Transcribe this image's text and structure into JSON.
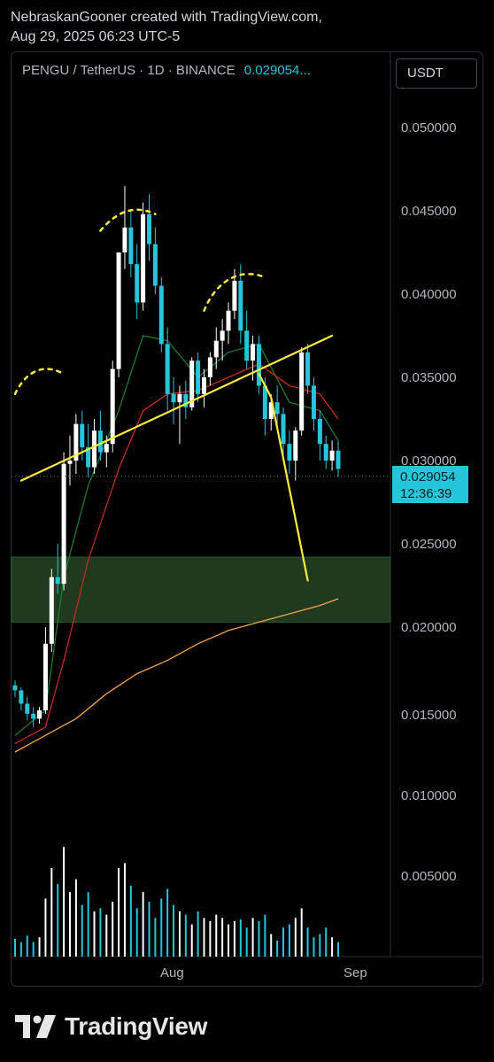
{
  "header": {
    "line1": "NebraskanGooner created with TradingView.com,",
    "line2": "Aug 29, 2025 06:23 UTC-5"
  },
  "symbol": {
    "label": "PENGU / TetherUS · 1D · BINANCE",
    "price": "0.029054..."
  },
  "currency_button": "USDT",
  "colors": {
    "up": "#ffffff",
    "down": "#26c6da",
    "accent": "#26c6da",
    "ema_short": "#1b7a2a",
    "ema_mid": "#c42b1c",
    "ema_long": "#f4a24c",
    "drawing": "#ffeb3b",
    "demand_zone": "#1f3a1f"
  },
  "brand": {
    "name": "TradingView",
    "icon": "tradingview-logo-icon"
  },
  "chart_data": {
    "type": "candlestick",
    "symbol": "PENGU / TetherUS",
    "timeframe": "1D",
    "exchange": "BINANCE",
    "last_price": "0.029054",
    "countdown": "12:36:39",
    "y_ticks": [
      "0.050000",
      "0.045000",
      "0.040000",
      "0.035000",
      "0.030000",
      "0.025000",
      "0.020000",
      "0.015000",
      "0.010000",
      "0.005000"
    ],
    "y_tick_values": [
      0.05,
      0.045,
      0.04,
      0.035,
      0.03,
      0.025,
      0.02,
      0.015,
      0.01,
      0.005
    ],
    "x_ticks": [
      "Aug",
      "Sep"
    ],
    "ylim": [
      0.0,
      0.0525
    ],
    "candle_count": 70,
    "ohlc": [
      [
        0.0165,
        0.0168,
        0.0158,
        0.0162
      ],
      [
        0.0162,
        0.0164,
        0.015,
        0.0154
      ],
      [
        0.0154,
        0.0158,
        0.0144,
        0.0148
      ],
      [
        0.0148,
        0.0152,
        0.014,
        0.0145
      ],
      [
        0.0145,
        0.0152,
        0.0142,
        0.015
      ],
      [
        0.015,
        0.02,
        0.0148,
        0.019
      ],
      [
        0.019,
        0.0235,
        0.0185,
        0.023
      ],
      [
        0.023,
        0.025,
        0.022,
        0.0226
      ],
      [
        0.0226,
        0.0305,
        0.0222,
        0.0298
      ],
      [
        0.0298,
        0.0315,
        0.0285,
        0.03
      ],
      [
        0.03,
        0.0328,
        0.0292,
        0.0322
      ],
      [
        0.0322,
        0.033,
        0.03,
        0.0308
      ],
      [
        0.0308,
        0.0322,
        0.029,
        0.0296
      ],
      [
        0.0296,
        0.0325,
        0.0292,
        0.0318
      ],
      [
        0.0318,
        0.033,
        0.03,
        0.0305
      ],
      [
        0.0305,
        0.0315,
        0.0296,
        0.031
      ],
      [
        0.031,
        0.036,
        0.0305,
        0.0355
      ],
      [
        0.0355,
        0.041,
        0.035,
        0.0425
      ],
      [
        0.0425,
        0.0465,
        0.0415,
        0.044
      ],
      [
        0.044,
        0.045,
        0.041,
        0.0418
      ],
      [
        0.0418,
        0.043,
        0.0385,
        0.0395
      ],
      [
        0.0395,
        0.0455,
        0.039,
        0.0448
      ],
      [
        0.0448,
        0.046,
        0.042,
        0.043
      ],
      [
        0.043,
        0.044,
        0.04,
        0.0405
      ],
      [
        0.0405,
        0.041,
        0.0365,
        0.037
      ],
      [
        0.037,
        0.038,
        0.033,
        0.034
      ],
      [
        0.034,
        0.035,
        0.0322,
        0.0335
      ],
      [
        0.0335,
        0.0345,
        0.031,
        0.034
      ],
      [
        0.034,
        0.0348,
        0.0325,
        0.0332
      ],
      [
        0.0332,
        0.0362,
        0.033,
        0.036
      ],
      [
        0.036,
        0.0365,
        0.0335,
        0.034
      ],
      [
        0.034,
        0.0355,
        0.0332,
        0.035
      ],
      [
        0.035,
        0.0365,
        0.0345,
        0.0362
      ],
      [
        0.0362,
        0.038,
        0.0355,
        0.0372
      ],
      [
        0.0372,
        0.0385,
        0.036,
        0.0378
      ],
      [
        0.0378,
        0.0395,
        0.037,
        0.039
      ],
      [
        0.039,
        0.0415,
        0.0385,
        0.0408
      ],
      [
        0.0408,
        0.0418,
        0.037,
        0.0378
      ],
      [
        0.0378,
        0.039,
        0.0355,
        0.036
      ],
      [
        0.036,
        0.0375,
        0.0348,
        0.037
      ],
      [
        0.037,
        0.0375,
        0.034,
        0.0345
      ],
      [
        0.0345,
        0.035,
        0.0315,
        0.0325
      ],
      [
        0.0325,
        0.034,
        0.0318,
        0.0335
      ],
      [
        0.0335,
        0.0345,
        0.032,
        0.0328
      ],
      [
        0.0328,
        0.0332,
        0.03,
        0.031
      ],
      [
        0.031,
        0.0318,
        0.0292,
        0.03
      ],
      [
        0.03,
        0.032,
        0.0288,
        0.0318
      ],
      [
        0.0318,
        0.0368,
        0.0315,
        0.0365
      ],
      [
        0.0365,
        0.037,
        0.034,
        0.0345
      ],
      [
        0.0345,
        0.035,
        0.0318,
        0.0325
      ],
      [
        0.0325,
        0.033,
        0.03,
        0.031
      ],
      [
        0.031,
        0.0315,
        0.0295,
        0.03
      ],
      [
        0.03,
        0.0312,
        0.0294,
        0.0306
      ],
      [
        0.0306,
        0.0312,
        0.029,
        0.0295
      ]
    ],
    "moving_averages": [
      {
        "points": [
          [
            0,
            0.0135
          ],
          [
            5,
            0.015
          ],
          [
            8,
            0.023
          ],
          [
            12,
            0.0285
          ],
          [
            17,
            0.033
          ],
          [
            21,
            0.0375
          ],
          [
            25,
            0.0372
          ],
          [
            30,
            0.035
          ],
          [
            35,
            0.0365
          ],
          [
            40,
            0.037
          ],
          [
            45,
            0.0335
          ],
          [
            50,
            0.033
          ],
          [
            53,
            0.0312
          ]
        ]
      },
      {
        "points": [
          [
            0,
            0.013
          ],
          [
            5,
            0.014
          ],
          [
            8,
            0.018
          ],
          [
            12,
            0.024
          ],
          [
            17,
            0.0295
          ],
          [
            21,
            0.033
          ],
          [
            25,
            0.034
          ],
          [
            30,
            0.0342
          ],
          [
            35,
            0.035
          ],
          [
            40,
            0.0358
          ],
          [
            45,
            0.0345
          ],
          [
            50,
            0.034
          ],
          [
            53,
            0.0325
          ]
        ]
      },
      {
        "points": [
          [
            0,
            0.0125
          ],
          [
            5,
            0.0135
          ],
          [
            10,
            0.0145
          ],
          [
            15,
            0.016
          ],
          [
            20,
            0.0172
          ],
          [
            25,
            0.018
          ],
          [
            30,
            0.019
          ],
          [
            35,
            0.0198
          ],
          [
            40,
            0.0203
          ],
          [
            45,
            0.0208
          ],
          [
            50,
            0.0213
          ],
          [
            53,
            0.0217
          ]
        ]
      }
    ],
    "volume": [
      0.0011,
      0.0009,
      0.0013,
      0.0009,
      0.0012,
      0.0036,
      0.0055,
      0.0045,
      0.0068,
      0.004,
      0.0048,
      0.0032,
      0.004,
      0.0028,
      0.003,
      0.0026,
      0.0034,
      0.0055,
      0.0058,
      0.0044,
      0.003,
      0.004,
      0.0034,
      0.0024,
      0.0036,
      0.0042,
      0.0032,
      0.0028,
      0.0026,
      0.002,
      0.0028,
      0.0024,
      0.0022,
      0.0026,
      0.0024,
      0.002,
      0.0022,
      0.0023,
      0.0018,
      0.0024,
      0.0022,
      0.0026,
      0.0014,
      0.001,
      0.0018,
      0.002,
      0.0024,
      0.003,
      0.0018,
      0.0012,
      0.0014,
      0.0018,
      0.0012,
      0.0009
    ],
    "demand_zone": [
      0.0203,
      0.0242
    ],
    "drawings": {
      "trendline": [
        [
          1,
          0.0288
        ],
        [
          52,
          0.0375
        ]
      ],
      "projection": [
        [
          40,
          0.0352
        ],
        [
          42,
          0.0338
        ],
        [
          48,
          0.0228
        ]
      ],
      "arcs": [
        [
          [
            0,
            0.034
          ],
          [
            2,
            0.0352
          ],
          [
            5,
            0.0355
          ],
          [
            8,
            0.0352
          ]
        ],
        [
          [
            14,
            0.0438
          ],
          [
            17,
            0.0448
          ],
          [
            20,
            0.045
          ],
          [
            23,
            0.0448
          ]
        ],
        [
          [
            31,
            0.039
          ],
          [
            33,
            0.0405
          ],
          [
            37,
            0.0413
          ],
          [
            41,
            0.041
          ]
        ]
      ]
    }
  }
}
